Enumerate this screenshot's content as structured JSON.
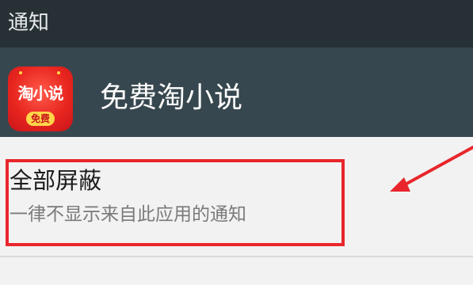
{
  "status_bar": {
    "title": "通知"
  },
  "app_header": {
    "app_name": "免费淘小说",
    "icon": {
      "name": "app-icon",
      "top_text": "淘小说",
      "badge_text": "免费"
    },
    "background_color": "#37474f"
  },
  "setting": {
    "title": "全部屏蔽",
    "summary": "一律不显示来自此应用的通知"
  },
  "annotation": {
    "color": "#e8262b"
  }
}
